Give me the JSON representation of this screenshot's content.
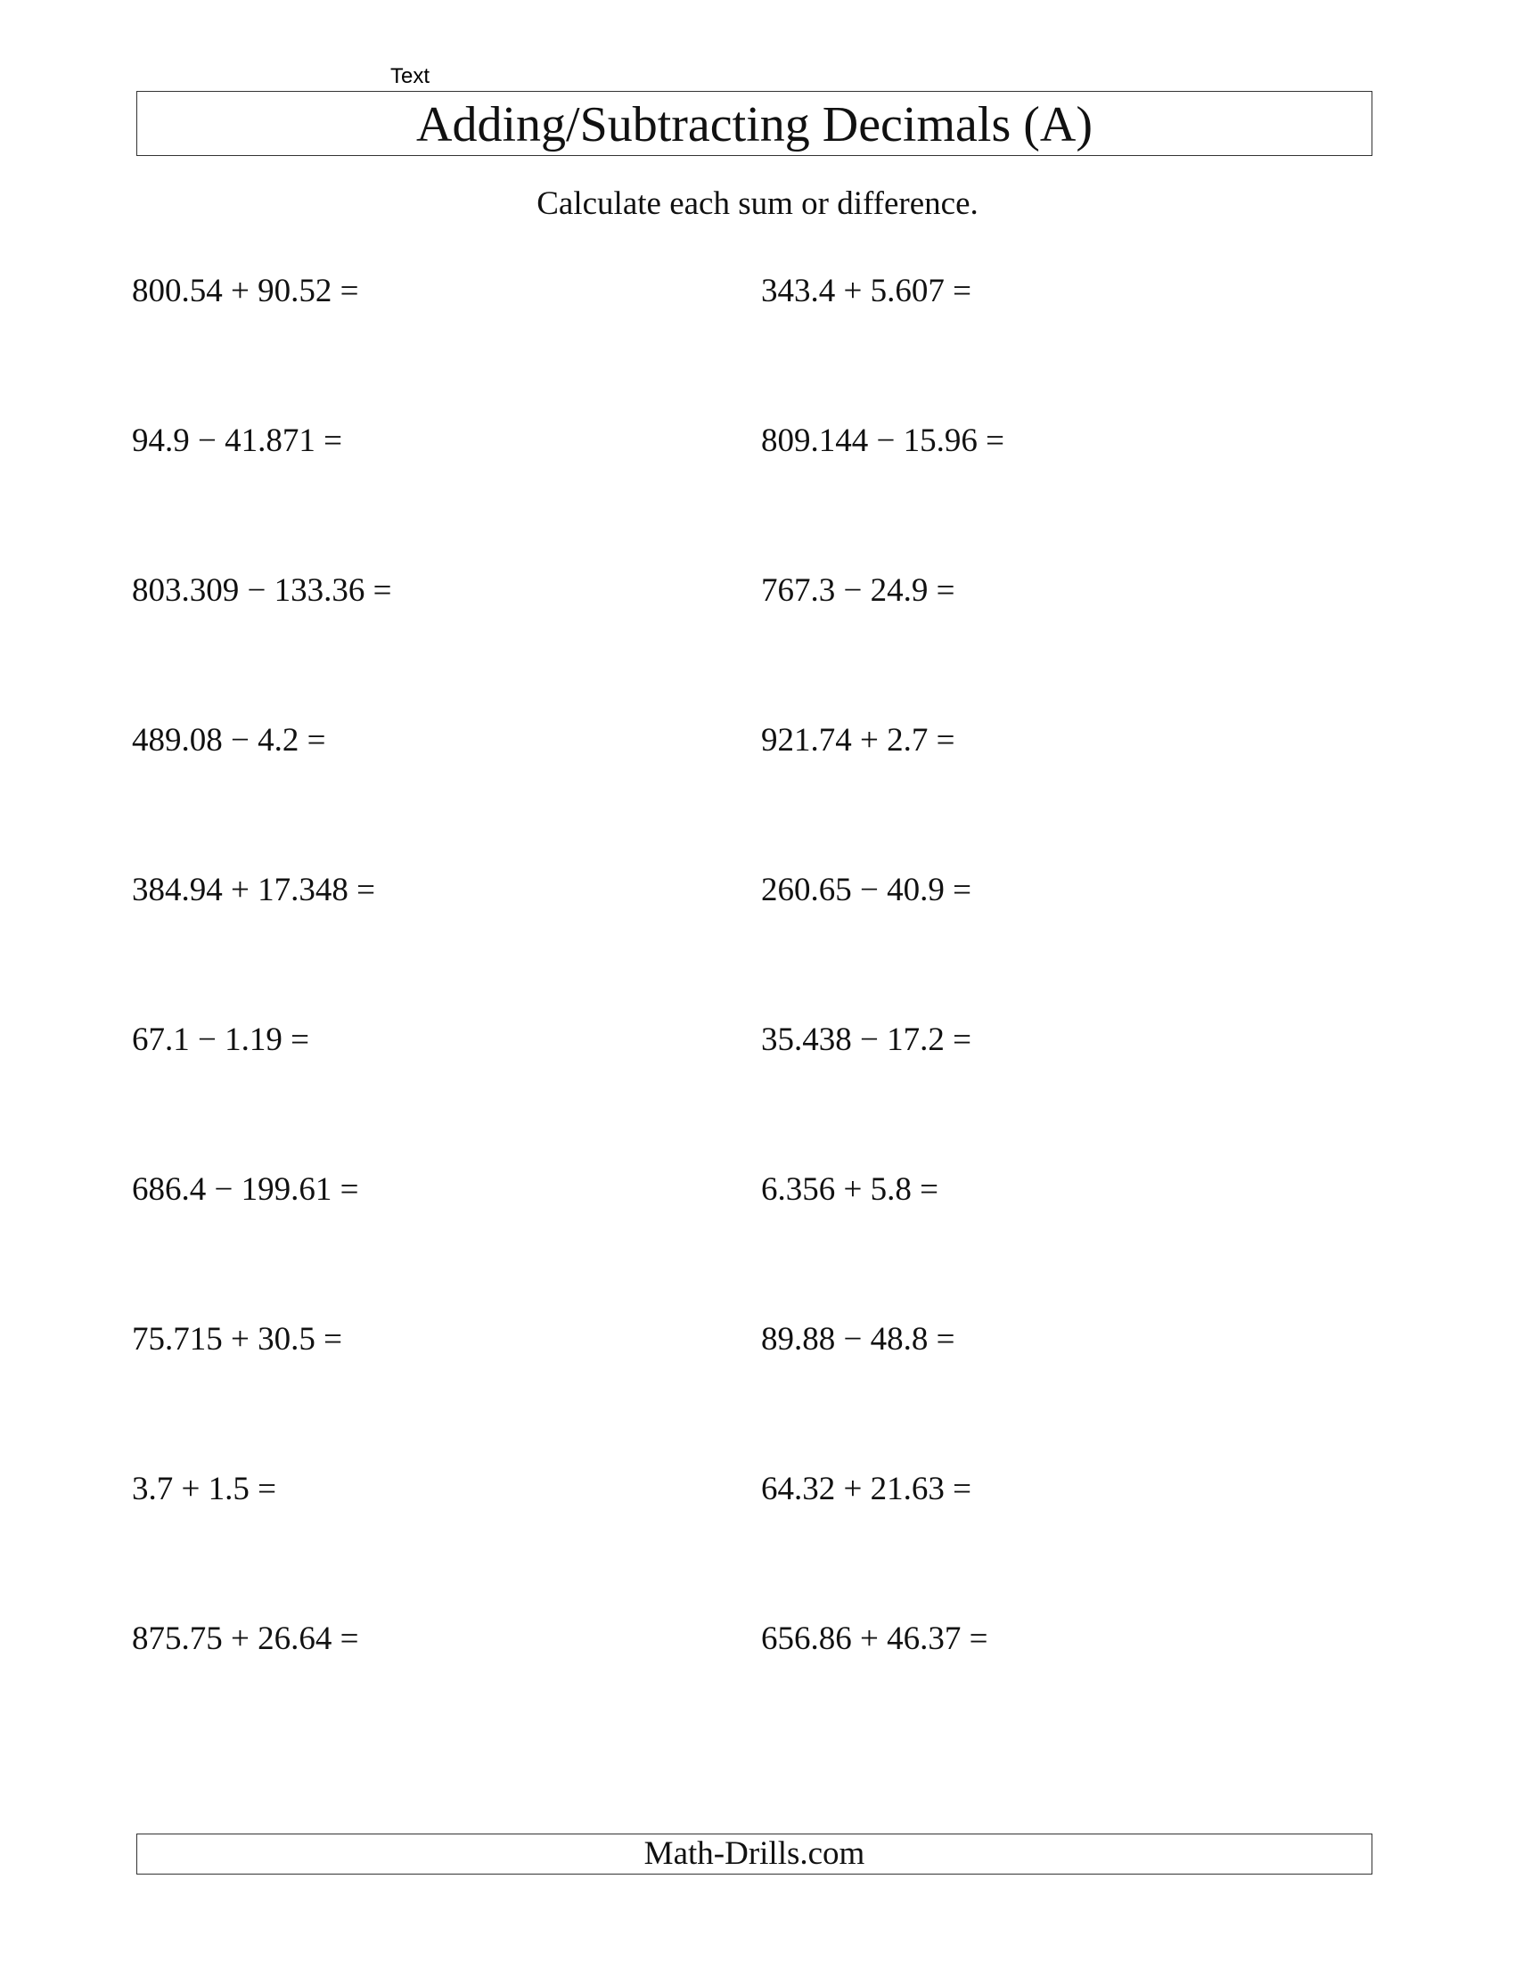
{
  "marker_text": "Text",
  "title": "Adding/Subtracting Decimals (A)",
  "instructions": "Calculate each sum or difference.",
  "problems": [
    "800.54 + 90.52 =",
    "343.4 + 5.607 =",
    "94.9 − 41.871 =",
    "809.144 − 15.96 =",
    "803.309 − 133.36 =",
    "767.3 − 24.9 =",
    "489.08 − 4.2 =",
    "921.74 + 2.7 =",
    "384.94 + 17.348 =",
    "260.65 − 40.9 =",
    "67.1 − 1.19 =",
    "35.438 − 17.2 =",
    "686.4 − 199.61 =",
    "6.356 + 5.8 =",
    "75.715 + 30.5 =",
    "89.88 − 48.8 =",
    "3.7 + 1.5 =",
    "64.32 + 21.63 =",
    "875.75 + 26.64 =",
    "656.86 + 46.37 ="
  ],
  "footer": "Math-Drills.com"
}
